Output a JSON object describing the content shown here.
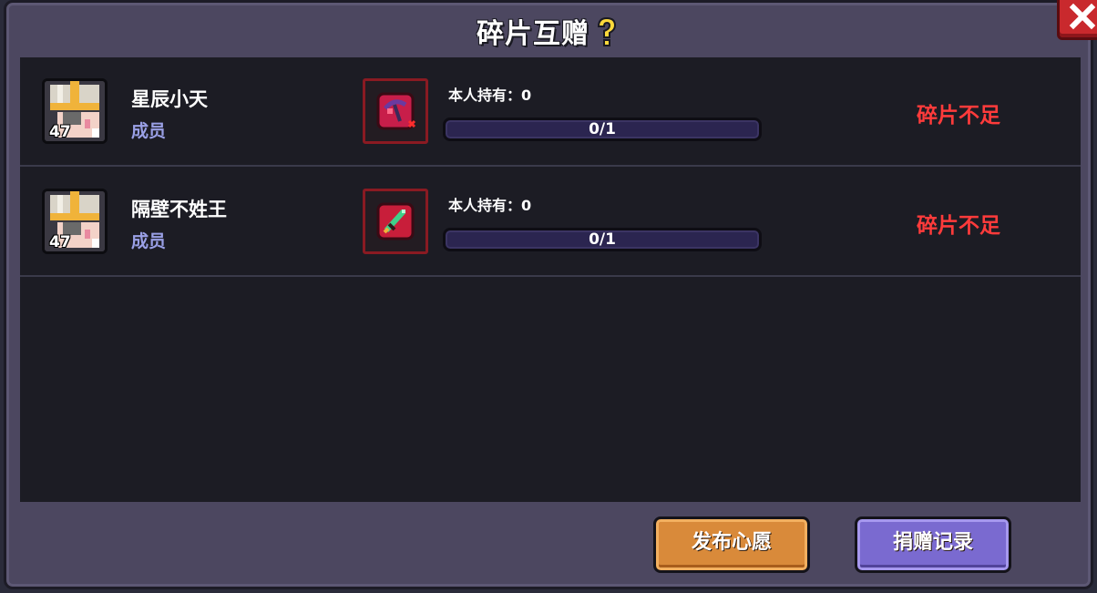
{
  "dialog": {
    "title": "碎片互赠",
    "help_icon": "question-mark-icon",
    "close_icon": "close-x-icon"
  },
  "rows": [
    {
      "name": "星辰小天",
      "role": "成员",
      "level": "47",
      "item_icon": "pickaxe-fragment-icon",
      "held_label": "本人持有：0",
      "progress_text": "0/1",
      "progress_fraction": 0,
      "status": "碎片不足"
    },
    {
      "name": "隔壁不姓王",
      "role": "成员",
      "level": "47",
      "item_icon": "sword-fragment-icon",
      "held_label": "本人持有：0",
      "progress_text": "0/1",
      "progress_fraction": 0,
      "status": "碎片不足"
    }
  ],
  "buttons": {
    "publish_wish": "发布心愿",
    "donation_log": "捐赠记录"
  },
  "colors": {
    "status_red": "#ff3b3b",
    "role_blue": "#9aa0e6",
    "wish_orange": "#d98a3a",
    "log_purple": "#7a6ad0"
  }
}
